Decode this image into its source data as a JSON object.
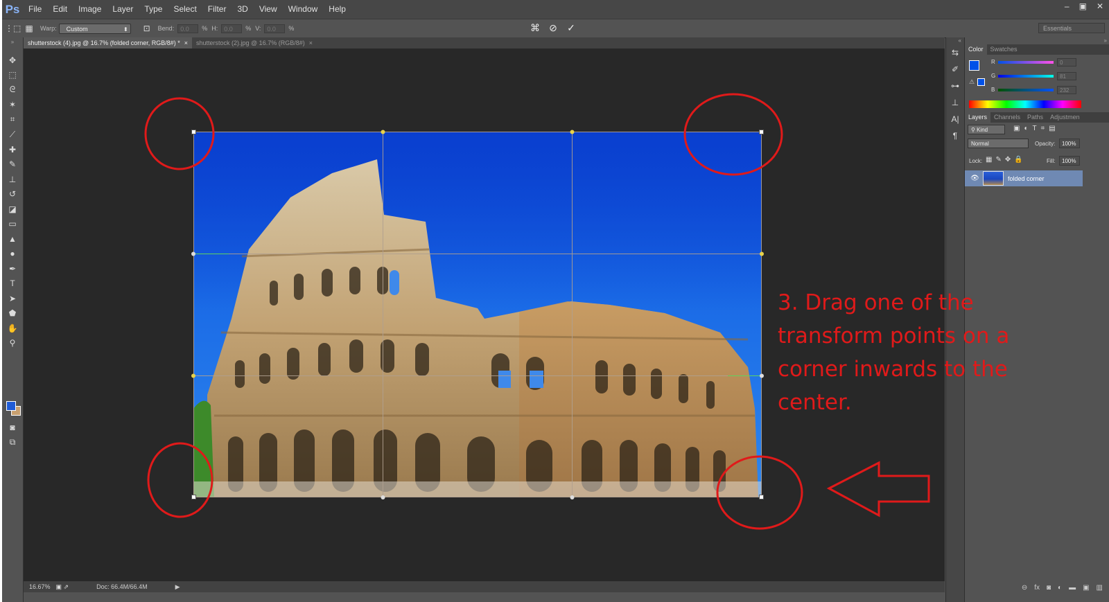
{
  "app": {
    "logo": "Ps"
  },
  "menu": [
    "File",
    "Edit",
    "Image",
    "Layer",
    "Type",
    "Select",
    "Filter",
    "3D",
    "View",
    "Window",
    "Help"
  ],
  "window_controls": [
    "–",
    "▣",
    "✕"
  ],
  "options_bar": {
    "warp_label": "Warp:",
    "warp_value": "Custom",
    "bend_label": "Bend:",
    "bend_value": "0.0",
    "h_label": "H:",
    "h_value": "0.0",
    "v_label": "V:",
    "v_value": "0.0",
    "percent": "%",
    "workspace": "Essentials"
  },
  "tabs": [
    {
      "label": "shutterstock (4).jpg @ 16.7% (folded corner, RGB/8#) *",
      "close": "×"
    },
    {
      "label": "shutterstock (2).jpg @ 16.7% (RGB/8#)",
      "close": "×"
    }
  ],
  "status": {
    "zoom": "16.67%",
    "doc": "Doc: 66.4M/66.4M",
    "arrow": "▶"
  },
  "color_panel": {
    "tabs": [
      "Color",
      "Swatches"
    ],
    "channels": [
      {
        "label": "R",
        "value": "0"
      },
      {
        "label": "G",
        "value": "81"
      },
      {
        "label": "B",
        "value": "232"
      }
    ],
    "foreground": "#0051e8"
  },
  "layers_panel": {
    "tabs": [
      "Layers",
      "Channels",
      "Paths",
      "Adjustmen"
    ],
    "kind": "Kind",
    "blend_mode": "Normal",
    "opacity_label": "Opacity:",
    "opacity_value": "100%",
    "lock_label": "Lock:",
    "fill_label": "Fill:",
    "fill_value": "100%",
    "layer_name": "folded corner",
    "footer_icons": [
      "link-icon",
      "fx-icon",
      "mask-icon",
      "adjustment-icon",
      "folder-icon",
      "new-layer-icon",
      "trash-icon"
    ],
    "fx_label": "fx"
  },
  "annotation": {
    "text": "3. Drag one of the transform points on a corner inwards to the center.",
    "color": "#e01a1a"
  }
}
